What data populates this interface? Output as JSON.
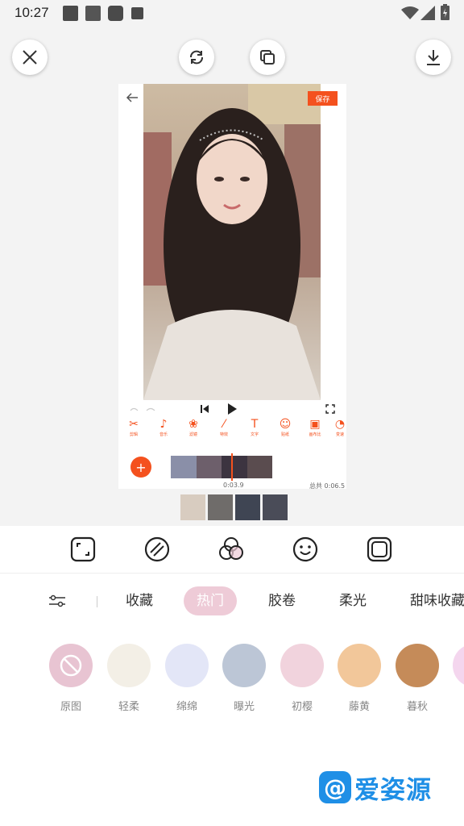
{
  "status_bar": {
    "time": "10:27"
  },
  "preview": {
    "save_label": "保存",
    "tools": [
      {
        "icon": "scissors-icon",
        "label": "剪辑"
      },
      {
        "icon": "music-note-icon",
        "label": "音乐"
      },
      {
        "icon": "filter-icon",
        "label": "滤镜"
      },
      {
        "icon": "magic-wand-icon",
        "label": "特效"
      },
      {
        "icon": "text-icon",
        "label": "文字"
      },
      {
        "icon": "sticker-icon",
        "label": "贴纸"
      },
      {
        "icon": "canvas-icon",
        "label": "画布比"
      },
      {
        "icon": "speed-icon",
        "label": "变速"
      }
    ],
    "current_time": "0:03.9",
    "total_time": "总共 0:06.5"
  },
  "filter_bar": {
    "categories": [
      "收藏",
      "热门",
      "胶卷",
      "柔光",
      "甜味收藏"
    ],
    "active_category": "热门"
  },
  "filters": [
    {
      "label": "原图",
      "color": "#e8c4d2"
    },
    {
      "label": "轻柔",
      "color": "#f3efe6"
    },
    {
      "label": "绵绵",
      "color": "#e3e6f7"
    },
    {
      "label": "曝光",
      "color": "#bcc6d6"
    },
    {
      "label": "初樱",
      "color": "#f1d3dd"
    },
    {
      "label": "藤黄",
      "color": "#f2c79a"
    },
    {
      "label": "暮秋",
      "color": "#c58b59"
    }
  ],
  "watermark": {
    "text": "爱姿源"
  },
  "colors": {
    "accent": "#f4511e",
    "pink": "#eecbd7",
    "brand_blue": "#1f8fe6"
  }
}
